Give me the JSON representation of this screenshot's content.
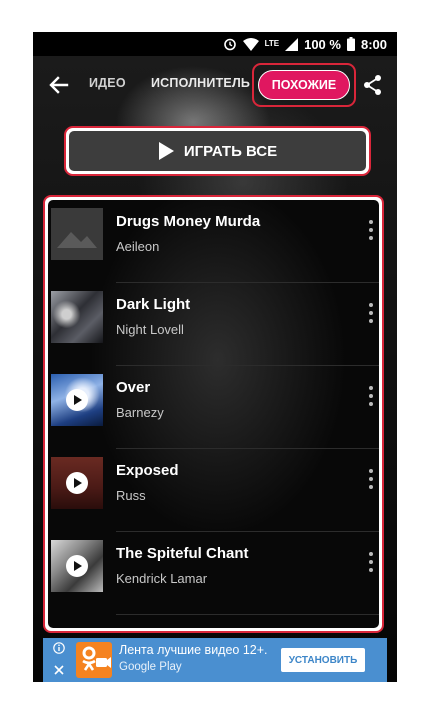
{
  "status_bar": {
    "network": "LTE",
    "battery": "100 %",
    "time": "8:00"
  },
  "top_bar": {
    "tab_video": "ИДЕО",
    "tab_artist": "ИСПОЛНИТЕЛЬ",
    "tab_similar": "ПОХОЖИЕ"
  },
  "play_all": {
    "label": "ИГРАТЬ ВСЕ"
  },
  "tracks": [
    {
      "title": "Drugs Money Murda",
      "artist": "Aeileon",
      "thumb": "placeholder-image-icon"
    },
    {
      "title": "Dark Light",
      "artist": "Night Lovell",
      "thumb": "photo"
    },
    {
      "title": "Over",
      "artist": "Barnezy",
      "thumb": "photo-with-play"
    },
    {
      "title": "Exposed",
      "artist": "Russ",
      "thumb": "photo-with-play"
    },
    {
      "title": "The Spiteful Chant",
      "artist": "Kendrick Lamar",
      "thumb": "photo-with-play"
    }
  ],
  "ad": {
    "title": "Лента лучшие видео 12+.",
    "subtitle": "Google Play",
    "install_label": "УСТАНОВИТЬ"
  },
  "colors": {
    "accent": "#e01760",
    "highlight_border": "#d9263a",
    "ad_background": "#4a8fd0",
    "app_background": "#000000"
  }
}
